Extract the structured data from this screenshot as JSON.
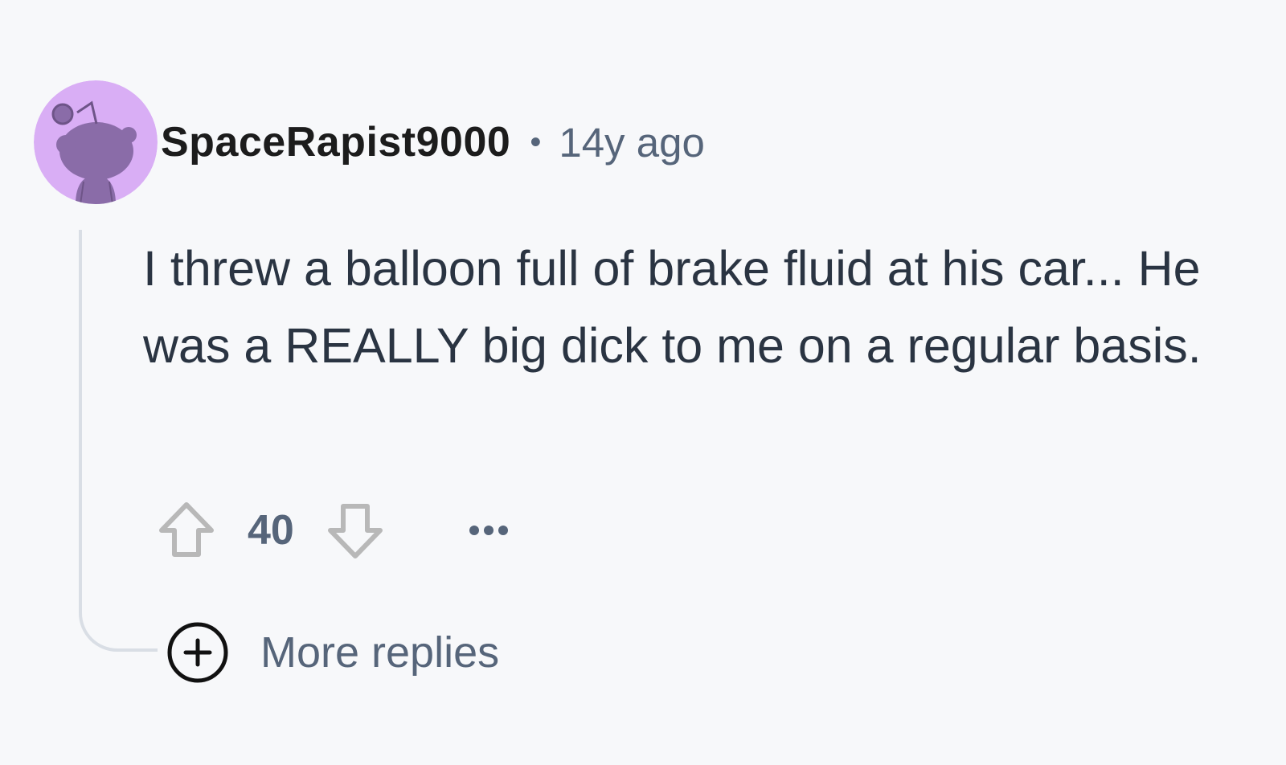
{
  "comment": {
    "username": "SpaceRapist9000",
    "separator": "•",
    "timestamp": "14y ago",
    "body": "I threw a balloon full of brake fluid at his car... He was a REALLY big dick to me on a regular basis.",
    "score": "40",
    "more_replies_label": "More replies"
  },
  "icons": {
    "avatar": "snoo-avatar-icon",
    "upvote": "arrow-up-icon",
    "downvote": "arrow-down-icon",
    "overflow": "more-horizontal-icon",
    "expand": "plus-circle-icon"
  },
  "colors": {
    "background": "#f7f8fa",
    "avatar_bg": "#d9aef5",
    "avatar_figure": "#8a6ca8",
    "username": "#1c1c1c",
    "meta": "#56657a",
    "body_text": "#2a3442",
    "thread_line": "#d9dee5",
    "vote_icon": "#b8b8b8"
  }
}
